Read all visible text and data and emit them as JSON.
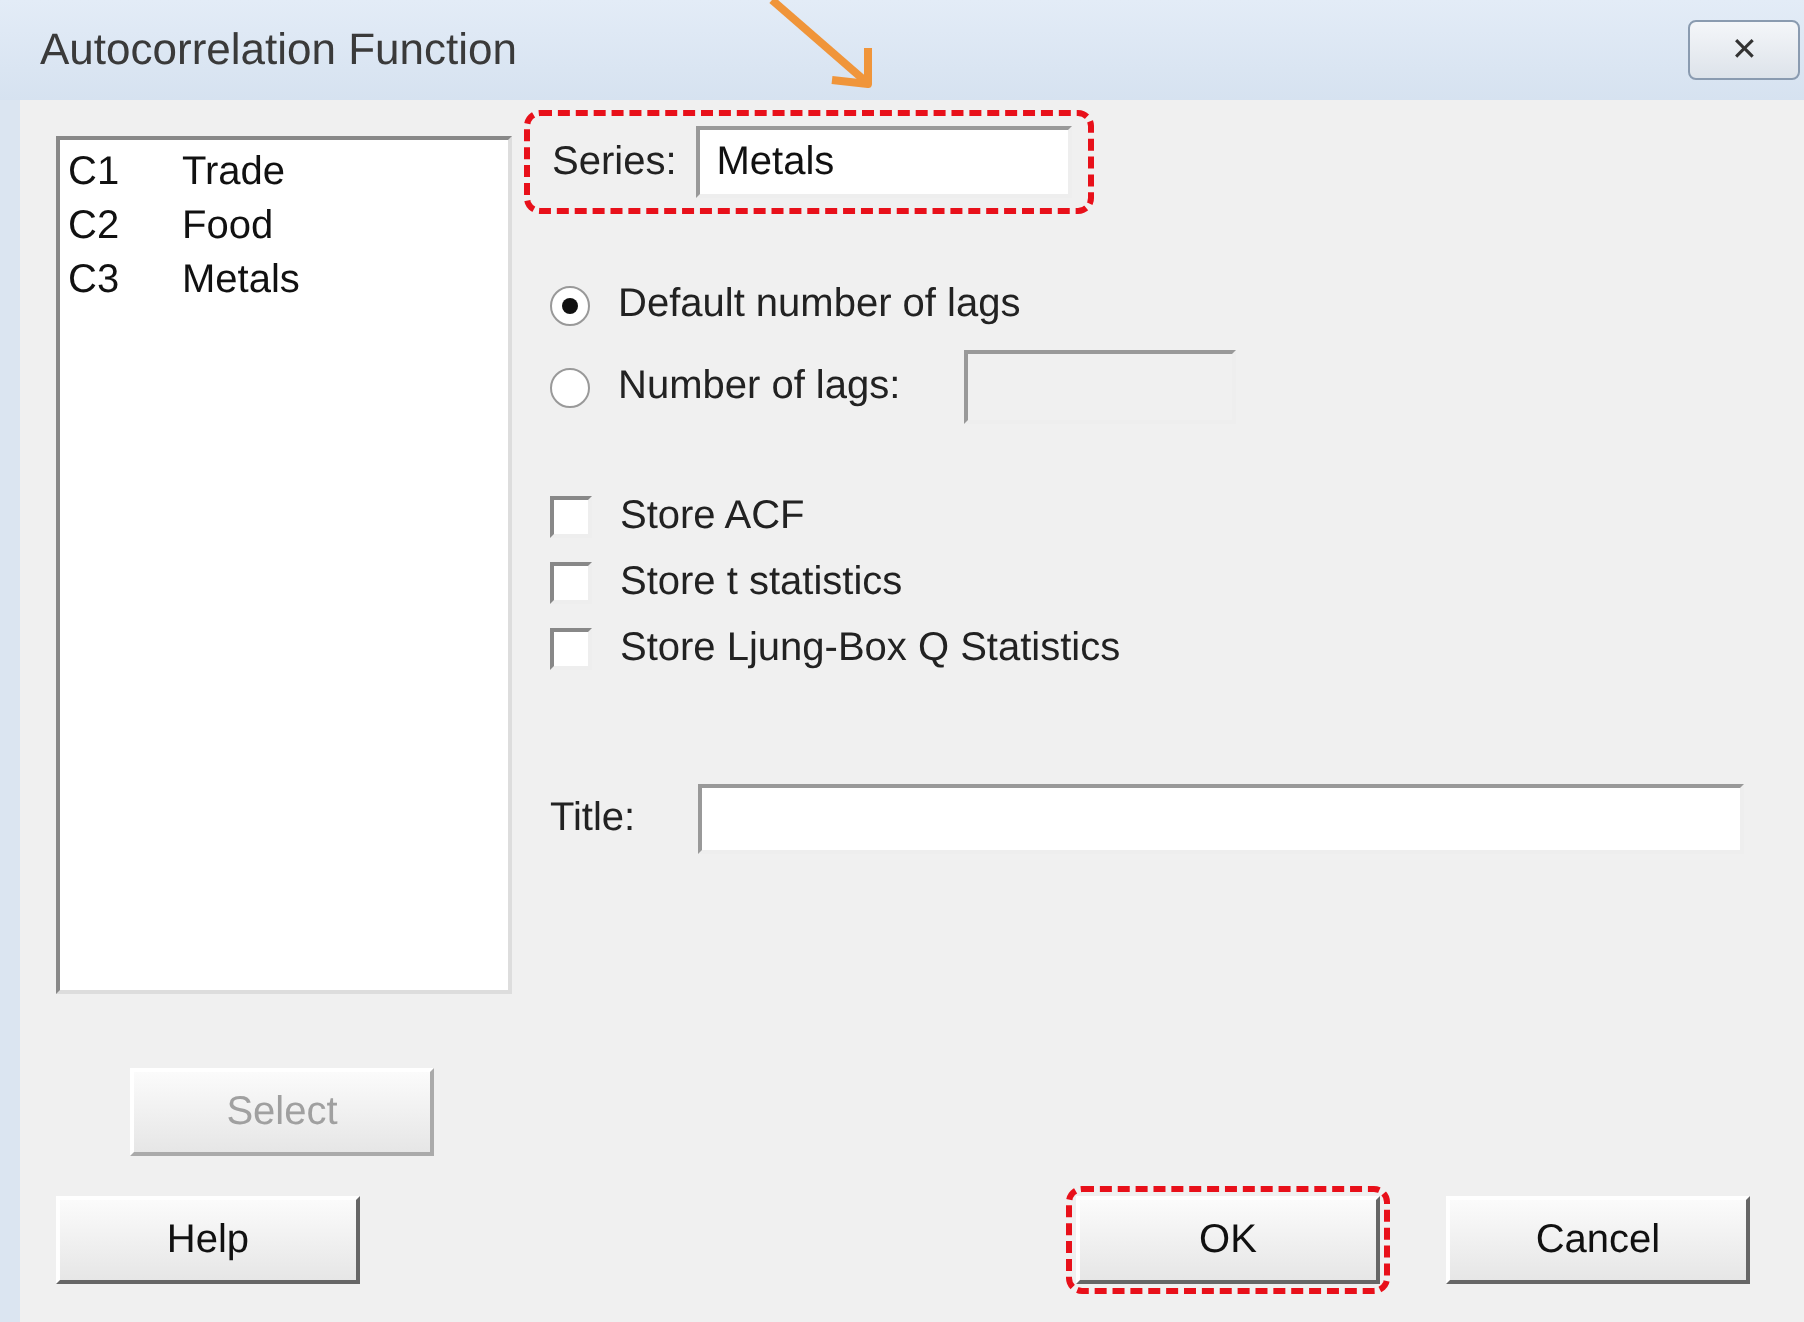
{
  "window": {
    "title": "Autocorrelation Function",
    "close": "✕"
  },
  "columns": [
    {
      "id": "C1",
      "name": "Trade"
    },
    {
      "id": "C2",
      "name": "Food"
    },
    {
      "id": "C3",
      "name": "Metals"
    }
  ],
  "series": {
    "label": "Series:",
    "value": "Metals",
    "highlighted": true,
    "pointed": true
  },
  "lags": [
    {
      "label": "Default number of lags",
      "selected": true,
      "kind": "plain"
    },
    {
      "label": "Number of lags:",
      "selected": false,
      "kind": "field"
    }
  ],
  "options": [
    {
      "label": "Store ACF",
      "checked": false
    },
    {
      "label": "Store t statistics",
      "checked": false
    },
    {
      "label": "Store Ljung-Box Q Statistics",
      "checked": false
    }
  ],
  "title_field": {
    "label": "Title:"
  },
  "select_button": {
    "label": "Select",
    "disabled": true
  },
  "buttons": [
    {
      "label": "Help",
      "highlighted": false
    },
    {
      "label": "OK",
      "highlighted": true
    },
    {
      "label": "Cancel",
      "highlighted": false
    }
  ]
}
